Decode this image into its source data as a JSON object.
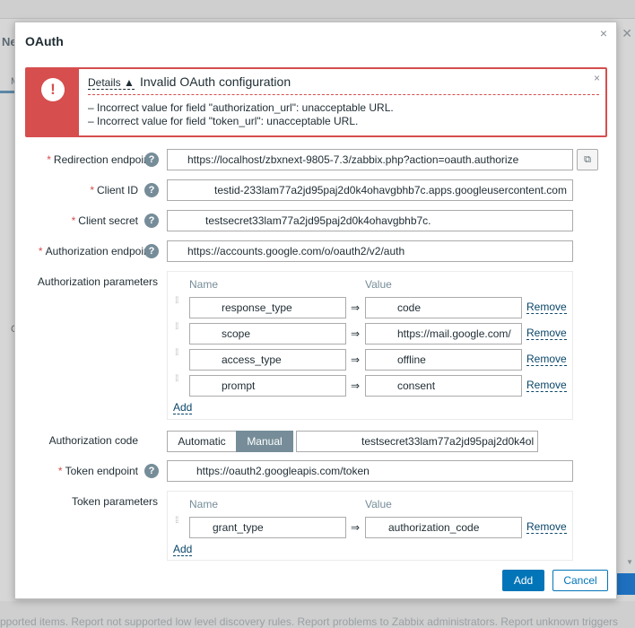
{
  "background": {
    "window_title": "Ne",
    "tab_label": "M",
    "side_letter": "C",
    "bottom_text": "pported items. Report not supported low level discovery rules. Report problems to Zabbix administrators. Report unknown triggers"
  },
  "modal": {
    "title": "OAuth",
    "close_icon": "×"
  },
  "error": {
    "icon": "!",
    "details_label": "Details ▲",
    "title": "Invalid OAuth configuration",
    "dismiss_icon": "×",
    "messages": [
      "–  Incorrect value for field \"authorization_url\": unacceptable URL.",
      "–  Incorrect value for field \"token_url\": unacceptable URL."
    ]
  },
  "form": {
    "redirection_endpoint": {
      "label": "Redirection endpoint",
      "value": "https://localhost/zbxnext-9805-7.3/zabbix.php?action=oauth.authorize"
    },
    "client_id": {
      "label": "Client ID",
      "value": "testid-233lam77a2jd95paj2d0k4ohavgbhb7c.apps.googleusercontent.com"
    },
    "client_secret": {
      "label": "Client secret",
      "value": "testsecret33lam77a2jd95paj2d0k4ohavgbhb7c."
    },
    "authorization_endpoint": {
      "label": "Authorization endpoint",
      "value": "https://accounts.google.com/o/oauth2/v2/auth"
    },
    "authorization_parameters": {
      "label": "Authorization parameters",
      "name_header": "Name",
      "value_header": "Value",
      "rows": [
        {
          "name": "response_type",
          "value": "code"
        },
        {
          "name": "scope",
          "value": "https://mail.google.com/"
        },
        {
          "name": "access_type",
          "value": "offline"
        },
        {
          "name": "prompt",
          "value": "consent"
        }
      ],
      "remove_label": "Remove",
      "add_label": "Add"
    },
    "authorization_code": {
      "label": "Authorization code",
      "options": [
        "Automatic",
        "Manual"
      ],
      "selected": "Manual",
      "value": "testsecret33lam77a2jd95paj2d0k4ol"
    },
    "token_endpoint": {
      "label": "Token endpoint",
      "value": "https://oauth2.googleapis.com/token"
    },
    "token_parameters": {
      "label": "Token parameters",
      "name_header": "Name",
      "value_header": "Value",
      "rows": [
        {
          "name": "grant_type",
          "value": "authorization_code"
        }
      ],
      "remove_label": "Remove",
      "add_label": "Add"
    },
    "arrow_symbol": "⇒",
    "help_symbol": "?",
    "required_mark": "*"
  },
  "footer": {
    "add_label": "Add",
    "cancel_label": "Cancel"
  },
  "colors": {
    "error_red": "#d64e4e",
    "primary_blue": "#0275b8",
    "help_gray": "#768d99"
  }
}
